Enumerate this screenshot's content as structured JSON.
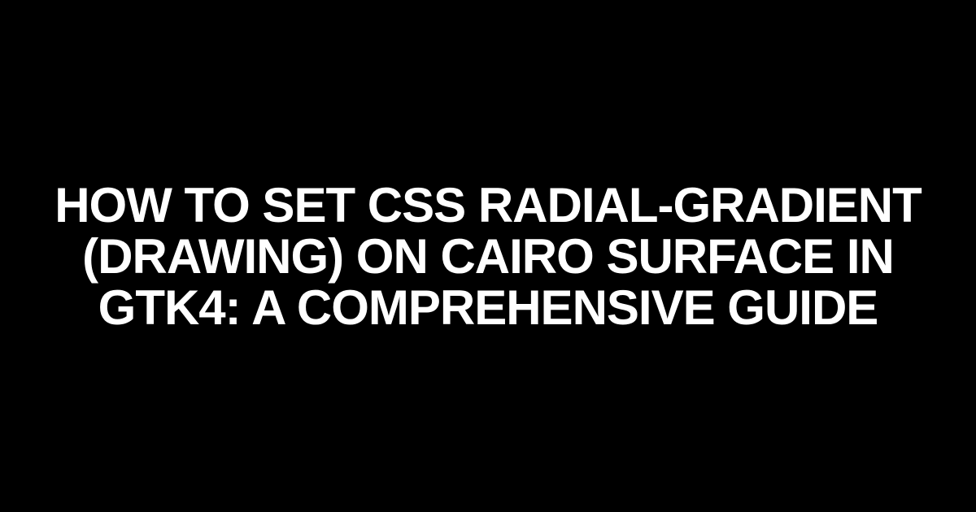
{
  "title": "How to Set CSS Radial-Gradient (Drawing) on Cairo Surface in GTK4: A Comprehensive Guide",
  "colors": {
    "background": "#000000",
    "text": "#ffffff"
  }
}
